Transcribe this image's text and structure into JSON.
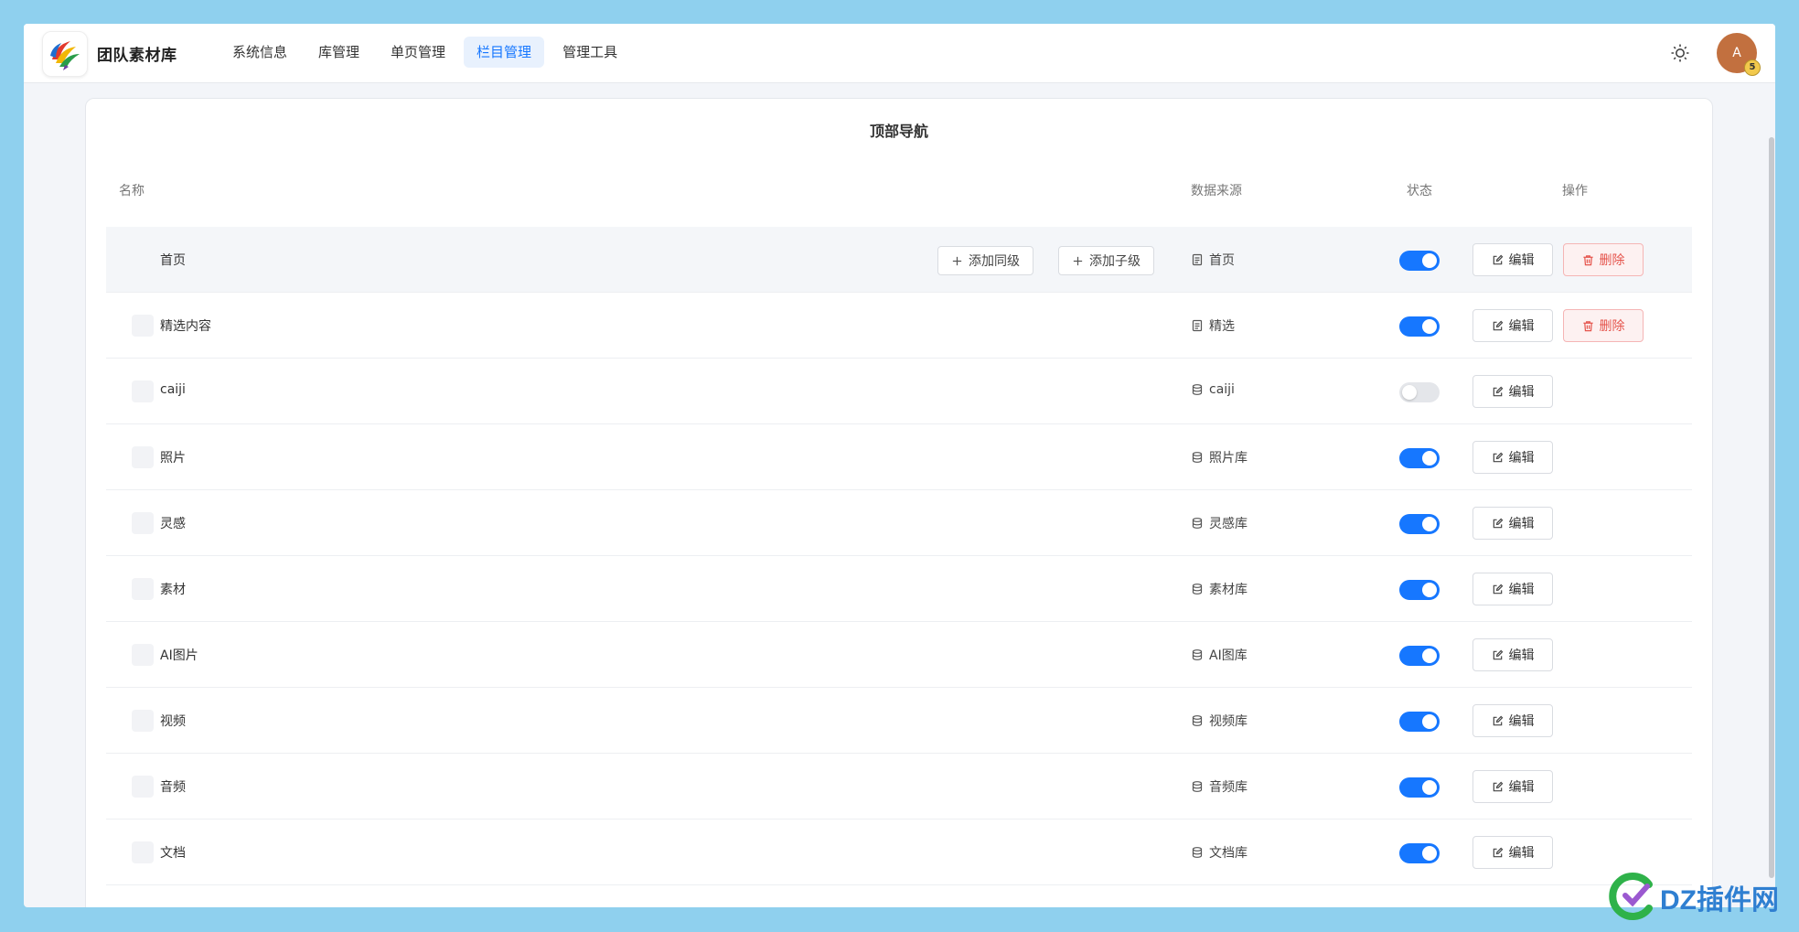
{
  "app": {
    "brand": "团队素材库",
    "nav": [
      {
        "label": "系统信息",
        "active": false
      },
      {
        "label": "库管理",
        "active": false
      },
      {
        "label": "单页管理",
        "active": false
      },
      {
        "label": "栏目管理",
        "active": true
      },
      {
        "label": "管理工具",
        "active": false
      }
    ],
    "avatar_initial": "A",
    "avatar_badge": "5",
    "accent_color": "#1677ff"
  },
  "card": {
    "title": "顶部导航",
    "columns": {
      "name": "名称",
      "source": "数据来源",
      "status": "状态",
      "actions": "操作"
    },
    "add_sibling_label": "添加同级",
    "add_child_label": "添加子级",
    "edit_label": "编辑",
    "delete_label": "删除",
    "rows": [
      {
        "name": "首页",
        "source": "首页",
        "source_icon": "page-icon",
        "enabled": true,
        "deletable": true,
        "highlighted": true
      },
      {
        "name": "精选内容",
        "source": "精选",
        "source_icon": "page-icon",
        "enabled": true,
        "deletable": true
      },
      {
        "name": "caiji",
        "source": "caiji",
        "source_icon": "database-icon",
        "enabled": false,
        "deletable": false
      },
      {
        "name": "照片",
        "source": "照片库",
        "source_icon": "database-icon",
        "enabled": true,
        "deletable": false
      },
      {
        "name": "灵感",
        "source": "灵感库",
        "source_icon": "database-icon",
        "enabled": true,
        "deletable": false
      },
      {
        "name": "素材",
        "source": "素材库",
        "source_icon": "database-icon",
        "enabled": true,
        "deletable": false
      },
      {
        "name": "AI图片",
        "source": "AI图库",
        "source_icon": "database-icon",
        "enabled": true,
        "deletable": false
      },
      {
        "name": "视频",
        "source": "视频库",
        "source_icon": "database-icon",
        "enabled": true,
        "deletable": false
      },
      {
        "name": "音频",
        "source": "音频库",
        "source_icon": "database-icon",
        "enabled": true,
        "deletable": false
      },
      {
        "name": "文档",
        "source": "文档库",
        "source_icon": "database-icon",
        "enabled": true,
        "deletable": false
      }
    ]
  },
  "watermark": {
    "text": "DZ插件网"
  }
}
